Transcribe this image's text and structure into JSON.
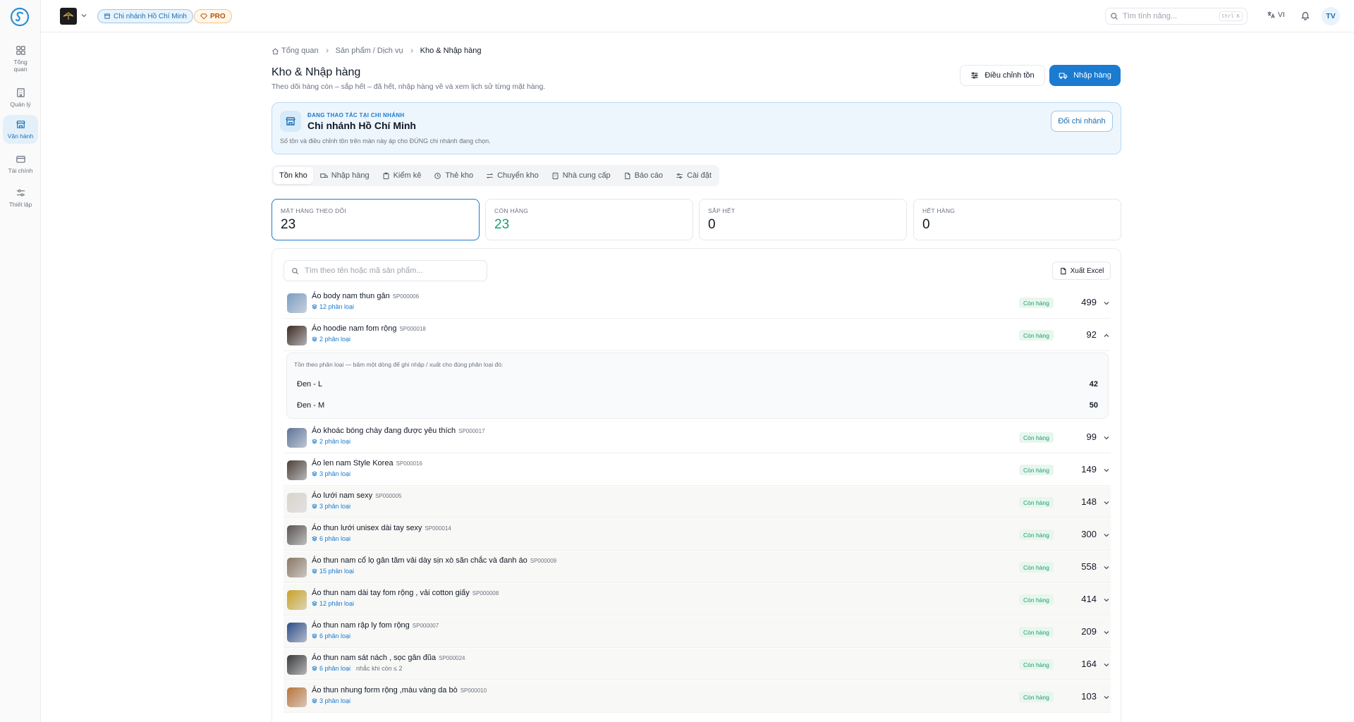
{
  "sidebar": {
    "items": [
      {
        "label": "Tổng\nquan",
        "icon": "grid-icon"
      },
      {
        "label": "Quản lý",
        "icon": "building-icon"
      },
      {
        "label": "Vận hành",
        "icon": "store-icon"
      },
      {
        "label": "Tài chính",
        "icon": "card-icon"
      },
      {
        "label": "Thiết lập",
        "icon": "sliders-icon"
      }
    ]
  },
  "topbar": {
    "branch": "Chi nhánh Hồ Chí Minh",
    "plan": "PRO",
    "search_placeholder": "Tìm tính năng...",
    "shortcut": "Ctrl K",
    "lang": "VI",
    "user_initials": "TV"
  },
  "breadcrumb": [
    "Tổng quan",
    "Sản phẩm / Dịch vụ",
    "Kho & Nhập hàng"
  ],
  "page": {
    "title": "Kho & Nhập hàng",
    "subtitle": "Theo dõi hàng còn – sắp hết – đã hết, nhập hàng về và xem lịch sử từng mặt hàng.",
    "adjust_btn": "Điều chỉnh tồn",
    "import_btn": "Nhập hàng"
  },
  "branch_card": {
    "kicker": "ĐANG THAO TÁC TẠI CHI NHÁNH",
    "name": "Chi nhánh Hồ Chí Minh",
    "note": "Số tồn và điều chỉnh tồn trên màn này áp cho ĐÚNG chi nhánh đang chọn.",
    "switch_btn": "Đổi chi nhánh"
  },
  "tabs": [
    {
      "label": "Tồn kho",
      "icon": ""
    },
    {
      "label": "Nhập hàng",
      "icon": "truck-icon"
    },
    {
      "label": "Kiểm kê",
      "icon": "clipboard-icon"
    },
    {
      "label": "Thẻ kho",
      "icon": "history-icon"
    },
    {
      "label": "Chuyển kho",
      "icon": "transfer-icon"
    },
    {
      "label": "Nhà cung cấp",
      "icon": "building-icon"
    },
    {
      "label": "Báo cáo",
      "icon": "file-icon"
    },
    {
      "label": "Cài đặt",
      "icon": "settings-icon"
    }
  ],
  "stats": [
    {
      "label": "MẶT HÀNG THEO DÕI",
      "value": "23"
    },
    {
      "label": "CÒN HÀNG",
      "value": "23"
    },
    {
      "label": "SẮP HẾT",
      "value": "0"
    },
    {
      "label": "HẾT HÀNG",
      "value": "0"
    }
  ],
  "list": {
    "search_placeholder": "Tìm theo tên hoặc mã sản phẩm...",
    "export_btn": "Xuất Excel",
    "expanded_note": "Tồn theo phân loại — bấm một dòng để ghi nhập / xuất cho đúng phân loại đó:",
    "expanded_variants": [
      {
        "name": "Đen - L",
        "qty": "42"
      },
      {
        "name": "Đen - M",
        "qty": "50"
      }
    ],
    "rows": [
      {
        "name": "Áo body nam thun gân",
        "code": "SP000006",
        "variants": "12 phân loại",
        "note": "",
        "status": "Còn hàng",
        "qty": "499",
        "expanded": false,
        "thumb": "#7a9cc0"
      },
      {
        "name": "Áo hoodie nam fom rộng",
        "code": "SP000018",
        "variants": "2 phân loại",
        "note": "",
        "status": "Còn hàng",
        "qty": "92",
        "expanded": true,
        "thumb": "#3b2a22"
      },
      {
        "name": "Áo khoác bóng chày đang được yêu thích",
        "code": "SP000017",
        "variants": "2 phân loại",
        "note": "",
        "status": "Còn hàng",
        "qty": "99",
        "expanded": false,
        "thumb": "#5d7497"
      },
      {
        "name": "Áo len nam Style Korea",
        "code": "SP000016",
        "variants": "3 phân loại",
        "note": "",
        "status": "Còn hàng",
        "qty": "149",
        "expanded": false,
        "thumb": "#4a4038"
      },
      {
        "name": "Áo lưới nam sexy",
        "code": "SP000005",
        "variants": "3 phân loại",
        "note": "",
        "status": "Còn hàng",
        "qty": "148",
        "expanded": false,
        "thumb": "#d9d4cc"
      },
      {
        "name": "Áo thun lưới unisex dài tay sexy",
        "code": "SP000014",
        "variants": "6 phân loại",
        "note": "",
        "status": "Còn hàng",
        "qty": "300",
        "expanded": false,
        "thumb": "#5b5450"
      },
      {
        "name": "Áo thun nam cổ lọ gân tăm vải dày sịn xò săn chắc và đanh áo",
        "code": "SP000009",
        "variants": "15 phân loại",
        "note": "",
        "status": "Còn hàng",
        "qty": "558",
        "expanded": false,
        "thumb": "#8a7763"
      },
      {
        "name": "Áo thun nam dài tay fom rộng , vải cotton giấy",
        "code": "SP000008",
        "variants": "12 phân loại",
        "note": "",
        "status": "Còn hàng",
        "qty": "414",
        "expanded": false,
        "thumb": "#c9a227"
      },
      {
        "name": "Áo thun nam rập ly fom rộng",
        "code": "SP000007",
        "variants": "6 phân loại",
        "note": "",
        "status": "Còn hàng",
        "qty": "209",
        "expanded": false,
        "thumb": "#2e4c86"
      },
      {
        "name": "Áo thun nam sát nách , sọc gân đũa",
        "code": "SP000024",
        "variants": "6 phân loại",
        "note": "nhắc khi còn ≤ 2",
        "status": "Còn hàng",
        "qty": "164",
        "expanded": false,
        "thumb": "#3a3a3a"
      },
      {
        "name": "Áo thun nhung form rộng ,màu vàng da bò",
        "code": "SP000010",
        "variants": "3 phân loại",
        "note": "",
        "status": "Còn hàng",
        "qty": "103",
        "expanded": false,
        "thumb": "#b8743a"
      }
    ]
  },
  "colors": {
    "accent": "#1a7bd0",
    "success": "#1f9d6b"
  }
}
